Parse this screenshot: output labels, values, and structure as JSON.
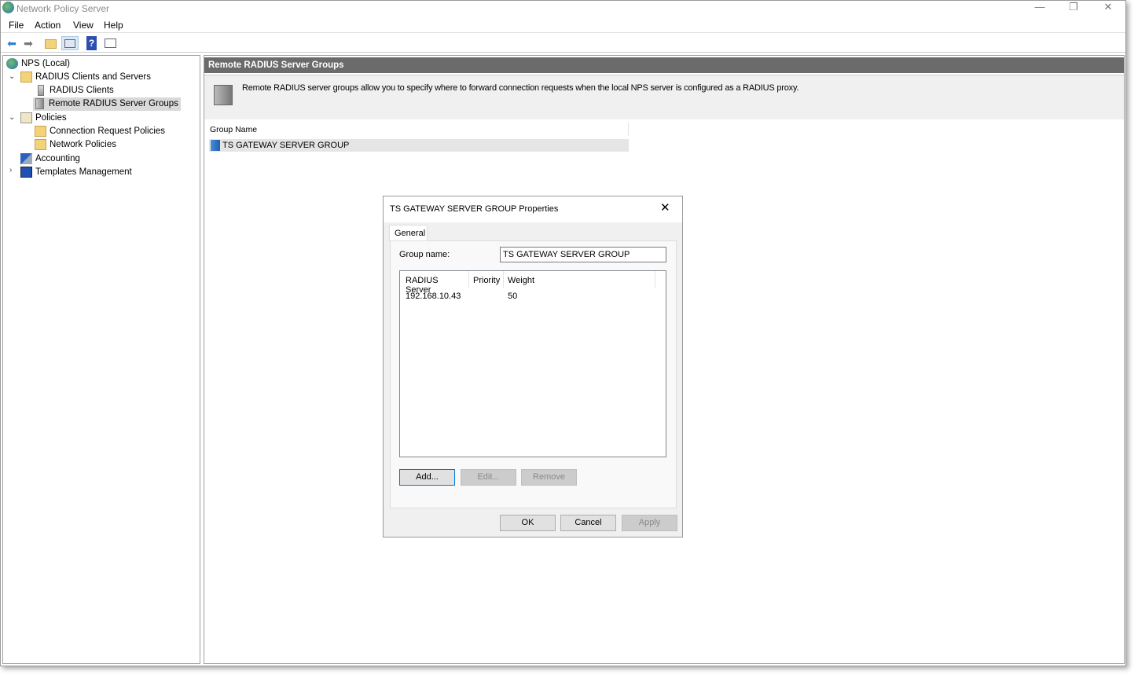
{
  "window": {
    "title": "Network Policy Server",
    "minimize": "—",
    "restore": "❐",
    "close": "✕"
  },
  "menu": [
    "File",
    "Action",
    "View",
    "Help"
  ],
  "toolbar": {
    "back": "back-icon",
    "forward": "forward-icon",
    "up": "folder-up-icon",
    "show_hide_tree": "console-tree-icon",
    "help": "help-icon",
    "action_pane": "action-pane-icon"
  },
  "tree": [
    {
      "label": "NPS (Local)",
      "icon": "globe-icon"
    },
    {
      "label": "RADIUS Clients and Servers",
      "icon": "folder-icon",
      "expanded": true
    },
    {
      "label": "RADIUS Clients",
      "icon": "server-icon"
    },
    {
      "label": "Remote RADIUS Server Groups",
      "icon": "server-group-icon",
      "selected": true
    },
    {
      "label": "Policies",
      "icon": "policy-icon",
      "expanded": true
    },
    {
      "label": "Connection Request Policies",
      "icon": "folder-icon"
    },
    {
      "label": "Network Policies",
      "icon": "folder-icon"
    },
    {
      "label": "Accounting",
      "icon": "accounting-icon"
    },
    {
      "label": "Templates Management",
      "icon": "templates-icon",
      "expanded": false
    }
  ],
  "main": {
    "header": "Remote RADIUS Server Groups",
    "description": "Remote RADIUS server groups allow you to specify where to forward connection requests when the local NPS server is configured as a RADIUS proxy.",
    "column": "Group Name",
    "rows": [
      "TS GATEWAY SERVER GROUP"
    ]
  },
  "dialog": {
    "title": "TS GATEWAY SERVER GROUP Properties",
    "close": "✕",
    "tab": "General",
    "group_name_label": "Group name:",
    "group_name_value": "TS GATEWAY SERVER GROUP",
    "columns": [
      "RADIUS Server",
      "Priority",
      "Weight"
    ],
    "servers": [
      {
        "server": "192.168.10.43",
        "priority": "",
        "weight": "50"
      }
    ],
    "add": "Add...",
    "edit": "Edit...",
    "remove": "Remove",
    "ok": "OK",
    "cancel": "Cancel",
    "apply": "Apply"
  },
  "colors": {
    "header_bar": "#6b6b6b",
    "selection": "#d9d9d9",
    "focus": "#0078d7"
  }
}
